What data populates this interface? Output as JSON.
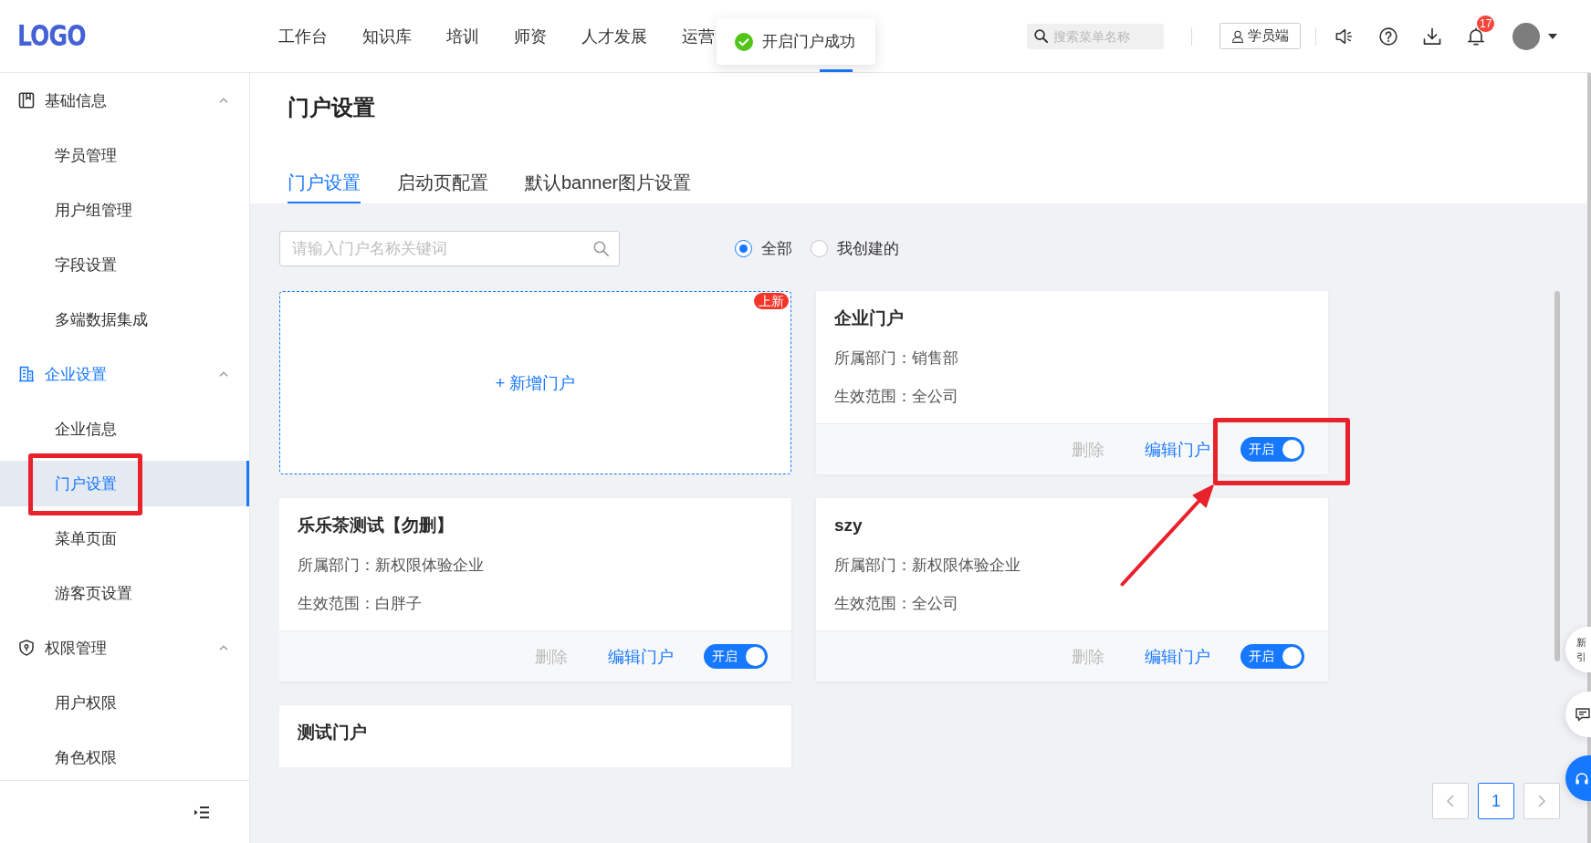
{
  "header": {
    "logo": "LOGO",
    "nav": [
      {
        "label": "工作台",
        "selected": false
      },
      {
        "label": "知识库",
        "selected": false
      },
      {
        "label": "培训",
        "selected": false
      },
      {
        "label": "师资",
        "selected": false
      },
      {
        "label": "人才发展",
        "selected": false
      },
      {
        "label": "运营",
        "selected": false
      }
    ],
    "covered_nav_item": {
      "selected": true
    },
    "search": {
      "placeholder": "搜索菜单名称"
    },
    "student_button": "学员端",
    "notification_badge": "17"
  },
  "toast": {
    "kind": "success",
    "message": "开启门户成功"
  },
  "sidebar": {
    "groups": [
      {
        "label": "基础信息",
        "active": false,
        "expanded": true,
        "children": [
          {
            "label": "学员管理",
            "selected": false
          },
          {
            "label": "用户组管理",
            "selected": false
          },
          {
            "label": "字段设置",
            "selected": false
          },
          {
            "label": "多端数据集成",
            "selected": false
          }
        ]
      },
      {
        "label": "企业设置",
        "active": true,
        "expanded": true,
        "children": [
          {
            "label": "企业信息",
            "selected": false
          },
          {
            "label": "门户设置",
            "selected": true
          },
          {
            "label": "菜单页面",
            "selected": false
          },
          {
            "label": "游客页设置",
            "selected": false
          }
        ]
      },
      {
        "label": "权限管理",
        "active": false,
        "expanded": true,
        "children": [
          {
            "label": "用户权限",
            "selected": false
          },
          {
            "label": "角色权限",
            "selected": false
          }
        ]
      }
    ]
  },
  "page": {
    "title": "门户设置",
    "tabs": [
      {
        "label": "门户设置",
        "selected": true
      },
      {
        "label": "启动页配置",
        "selected": false
      },
      {
        "label": "默认banner图片设置",
        "selected": false
      }
    ]
  },
  "filter": {
    "search": {
      "placeholder": "请输入门户名称关键词"
    },
    "options": [
      {
        "label": "全部",
        "selected": true
      },
      {
        "label": "我创建的",
        "selected": false
      }
    ]
  },
  "add_card": {
    "label": "+ 新增门户",
    "badge": "上新"
  },
  "portals": [
    {
      "name": "企业门户",
      "department": "所属部门：销售部",
      "scope": "生效范围：全公司",
      "delete": {
        "label": "删除",
        "disabled": true
      },
      "edit": "编辑门户",
      "switch": {
        "label": "开启",
        "on": true
      }
    },
    {
      "name": "乐乐茶测试【勿删】",
      "department": "所属部门：新权限体验企业",
      "scope": "生效范围：白胖子",
      "delete": {
        "label": "删除",
        "disabled": true
      },
      "edit": "编辑门户",
      "switch": {
        "label": "开启",
        "on": true
      }
    },
    {
      "name": "szy",
      "department": "所属部门：新权限体验企业",
      "scope": "生效范围：全公司",
      "delete": {
        "label": "删除",
        "disabled": true
      },
      "edit": "编辑门户",
      "switch": {
        "label": "开启",
        "on": true
      }
    },
    {
      "name": "测试门户"
    }
  ],
  "pagination": {
    "pages": [
      {
        "label": "1",
        "selected": true
      }
    ]
  },
  "float_buttons": {
    "guide_lines": [
      "新",
      "引"
    ]
  }
}
